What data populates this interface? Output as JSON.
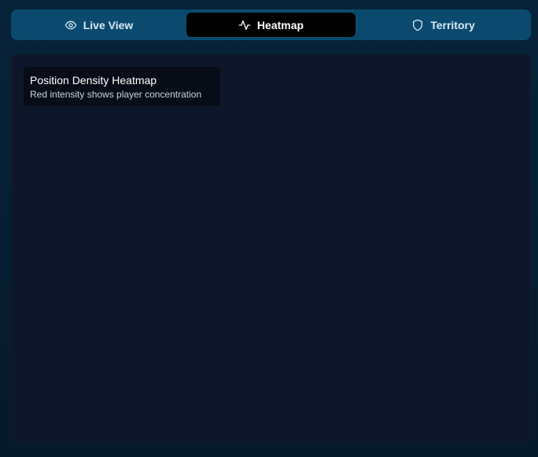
{
  "tabs": [
    {
      "label": "Live View",
      "icon": "eye-icon",
      "active": false
    },
    {
      "label": "Heatmap",
      "icon": "activity-icon",
      "active": true
    },
    {
      "label": "Territory",
      "icon": "shield-icon",
      "active": false
    }
  ],
  "heatmap": {
    "title": "Position Density Heatmap",
    "subtitle": "Red intensity shows player concentration"
  },
  "colors": {
    "tabbar_bg": "#0b4a6e",
    "active_tab_bg": "#000000",
    "panel_bg": "#0e1729",
    "page_bg": "#061a2a"
  }
}
